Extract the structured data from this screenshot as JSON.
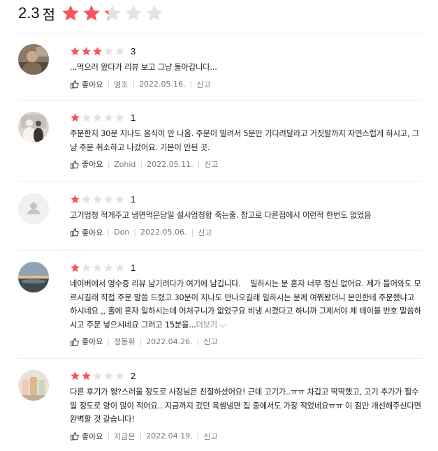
{
  "summary": {
    "score": "2.3",
    "unit": "점",
    "rating_fraction": 0.46
  },
  "labels": {
    "like": "좋아요",
    "report": "신고",
    "more": "더보기"
  },
  "colors": {
    "star_filled": "#f9525a",
    "star_empty": "#e2e2e2"
  },
  "reviews": [
    {
      "avatar": "photo-avatar",
      "rating": 3,
      "rating_text": "3",
      "text": "...먹으러 왔다가 리뷰 보고 그냥 돌아갑니다...",
      "author": "영조",
      "date": "2022.05.16."
    },
    {
      "avatar": "photo-avatar",
      "rating": 1,
      "rating_text": "1",
      "text": "주문한지 30분 지나도 음식이 안 나옴. 주문이 밀려서 5분만 기다려달라고 거짓말까지 자연스럽게 하시고, 그냥 주문 취소하고 나갔어요. 기본이 안된 곳.",
      "author": "Zohid",
      "date": "2022.05.11."
    },
    {
      "avatar": "default-user-icon",
      "rating": 1,
      "rating_text": "1",
      "text": "고기엄청 적게주고 냉면먹은당일 설사엄청함 죽는줄. 참고로 다른집에서 이런적 한번도 없었음",
      "author": "Don",
      "date": "2022.05.06."
    },
    {
      "avatar": "photo-avatar",
      "rating": 1,
      "rating_text": "1",
      "text": "네이버에서 영수증 리뷰 남기려다가 여기에 남깁니다.    일하시는 분 혼자 너무 정신 없어요. 제가 들어와도 모르시길래 직접 주문 말씀 드렸고 30분이 지나도 안나오길래 일하시는 분께 여쭤봤더니 본인한테 주문했냐고 하시네요 ,, 홀에 혼자 일하시는데 어처구니가 없었구요 비냉 시켰다고 하니까 그제서야 제 테이블 번호 말씀하시고 주문 넣으시네요 그러고 15분을...",
      "author": "정동휘",
      "date": "2022.04.26."
    },
    {
      "avatar": "photo-avatar",
      "rating": 2,
      "rating_text": "2",
      "text": "다른 후기가 왱?스러울 정도로 사장님은 친절하셨어요! 근데 고기가..ㅠㅠ 차갑고 딱딱했고, 고기 추가가 필수일 정도로 양이 많이 적어요.. 지금까지 갔던 육쌈냉면 집 중에서도 가장 적었네요ㅠㅠ 이 점만 개선해주신다면 완벽할 것 같습니다!",
      "author": "지금은",
      "date": "2022.04.19."
    }
  ]
}
